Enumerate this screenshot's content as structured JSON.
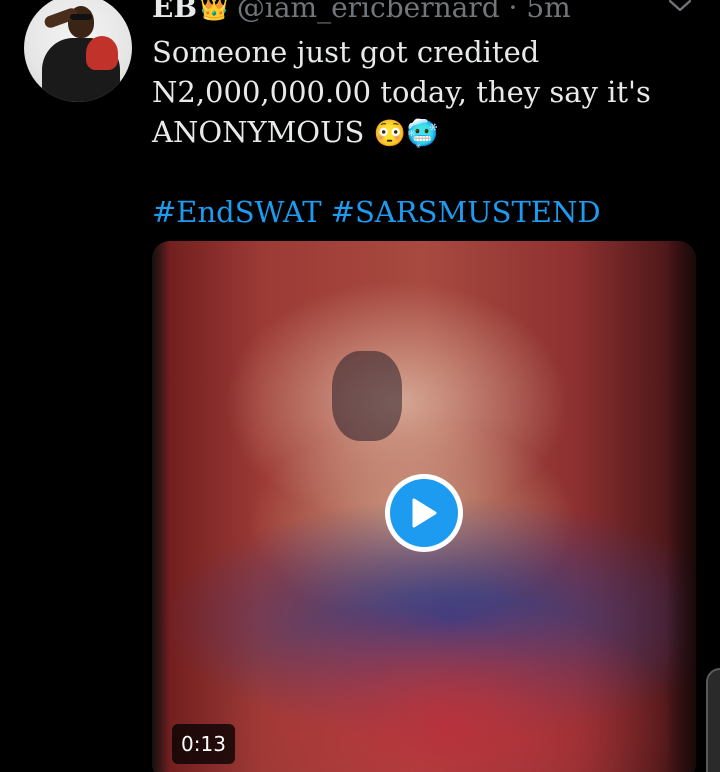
{
  "tweet": {
    "author_name": "EB",
    "author_badge": "👑",
    "handle_time": "@iam_ericbernard · 5m",
    "text_lines": [
      "Someone just got credited",
      "N2,000,000.00 today, they say it's",
      "ANONYMOUS"
    ],
    "emojis": [
      "😳",
      "🥶"
    ],
    "hashtags": [
      "#EndSWAT",
      "#SARSMUSTEND"
    ]
  },
  "video": {
    "duration": "0:13"
  },
  "icons": {
    "more": "chevron-down-icon",
    "play": "play-icon"
  },
  "colors": {
    "background": "#000000",
    "link": "#1d9bf0",
    "secondary_text": "#71767b",
    "play_button": "#1d9bf0"
  }
}
